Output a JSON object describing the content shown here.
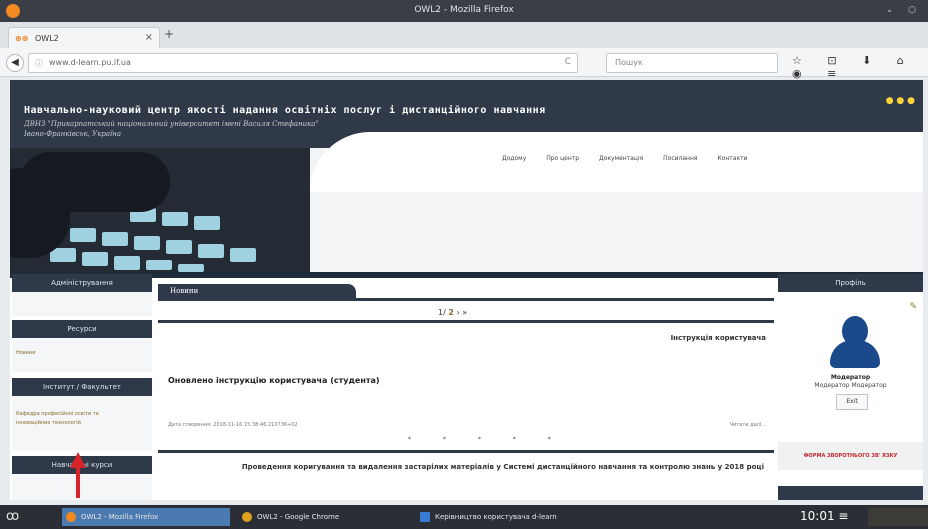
{
  "window": {
    "title": "OWL2 - Mozilla Firefox"
  },
  "tab": {
    "label": "OWL2",
    "favicon": "owl-favicon",
    "close": "×"
  },
  "new_tab": "+",
  "navbar": {
    "back": "◀",
    "url": "www.d-learn.pu.if.ua",
    "reload": "C",
    "search_placeholder": "Пошук",
    "icons": "☆ ⊡ ⬇ ⌂ ◉ ≡"
  },
  "banner": {
    "title": "Навчально-науковий центр якості надання освітніх послуг і дистанційного навчання",
    "subtitle": "ДВНЗ \"Прикарпатський національний університет імені Василя Стефаника\"",
    "location": "Івано-Франківськ, Україна",
    "menu": [
      "Додому",
      "Про центр",
      "Документація",
      "Посилання",
      "Контакти"
    ]
  },
  "left": {
    "admin": "Адміністрування",
    "resources": "Ресурси",
    "resources_link": "Новини",
    "institute": "Інститут / Факультет",
    "dept_link": "Кафедра професійної освіти та інноваційних технологій",
    "services": "Навчальні курси"
  },
  "center": {
    "tab": "Новини",
    "pager": {
      "current": "1/",
      "next": "2",
      "arrows": "› »"
    },
    "instr_title": "Інструкція користувача",
    "headline": "Оновлено інструкцію користувача (студента)",
    "meta": "Дата створення: 2018-11-16 15:38:46.210736+02",
    "more": "Читати далі...",
    "stars": "* * * * *",
    "news2": "Проведення коригування та видалення застарілих матеріалів у Системі дистанційного навчання та контролю знань у 2018 році"
  },
  "right": {
    "profile": "Профіль",
    "role1": "Модератор",
    "role2": "Модератор Модератор",
    "exit": "Exit",
    "feedback": "ФОРМА ЗВОРОТНЬОГО ЗВ' ЯЗКУ"
  },
  "taskbar": {
    "start": "ꝏ",
    "items": [
      "OWL2 - Mozilla Firefox",
      "OWL2 - Google Chrome",
      "Керівництво користувача d-learn"
    ],
    "clock": "10:01 ≡"
  },
  "colors": {
    "header": "#2e3a49",
    "arrow": "#d8232a",
    "link": "#8a6a2a"
  }
}
